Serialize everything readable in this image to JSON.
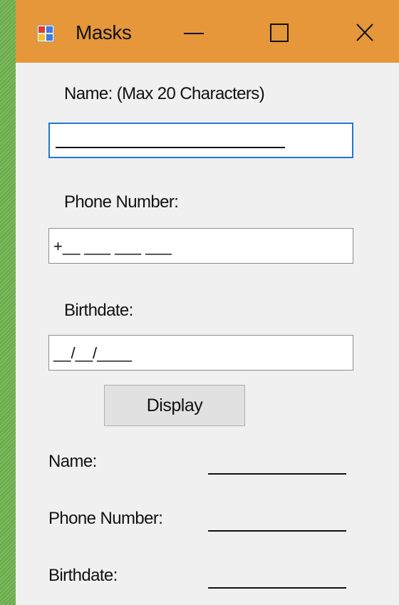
{
  "window": {
    "title": "Masks",
    "icon": "winforms-app-icon",
    "controls": {
      "minimize_icon": "minimize-icon",
      "maximize_icon": "maximize-icon",
      "close_icon": "close-icon"
    },
    "titlebar_color": "#e5973a",
    "background_color": "#f0f0f0"
  },
  "form": {
    "name": {
      "label": "Name: (Max 20 Characters)",
      "value": ""
    },
    "phone": {
      "label": "Phone Number:",
      "mask": "+__ ___ ___ ___"
    },
    "birthdate": {
      "label": "Birthdate:",
      "mask": "__/__/____"
    },
    "display_button": "Display"
  },
  "output": {
    "name_label": "Name:",
    "phone_label": "Phone Number:",
    "birthdate_label": "Birthdate:",
    "name_value": "",
    "phone_value": "",
    "birthdate_value": ""
  }
}
